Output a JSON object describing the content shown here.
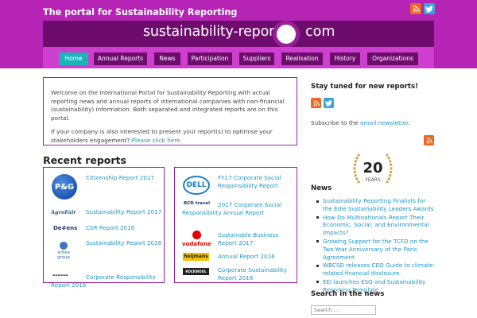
{
  "header": {
    "tagline": "The portal for Sustainability Reporting",
    "brand_left": "sustainability-reports",
    "brand_right": "com"
  },
  "nav": {
    "items": [
      {
        "label": "Home",
        "active": true
      },
      {
        "label": "Annual Reports",
        "active": false
      },
      {
        "label": "News",
        "active": false
      },
      {
        "label": "Participation",
        "active": false
      },
      {
        "label": "Suppliers",
        "active": false
      },
      {
        "label": "Realisation",
        "active": false
      },
      {
        "label": "History",
        "active": false
      },
      {
        "label": "Organizations",
        "active": false
      }
    ]
  },
  "welcome": {
    "para1": "Welcome on the International Portal for Sustainability Reporting with actual reporting news and annual reports of international companies with non-financial (sustainability) information. Both separated and integrated reports are on this portal.",
    "para2_prefix": "If your company is also interested to present your report(s) to optimise your stakeholders engagement?",
    "para2_link": "Please click here."
  },
  "recent": {
    "title": "Recent reports",
    "left": [
      {
        "logo": "P&G",
        "report": "Citizenship Report 2017"
      },
      {
        "logo": "AgroFair",
        "report": "Sustainability Report 2017"
      },
      {
        "logo": "De#ens",
        "report": "CSR Report 2016"
      },
      {
        "logo": "antea group",
        "report": "Sustainability Report 2016"
      },
      {
        "logo": "",
        "report": "Corporate Responsibility Report 2016"
      }
    ],
    "right": [
      {
        "logo": "DELL",
        "report": "FY17 Corporate Social Responsibility Report"
      },
      {
        "logo": "BCD travel",
        "report": "2017 Corporate Social Responsibility Annual Report"
      },
      {
        "logo": "vodafone",
        "report": "Sustainable Business Report 2017"
      },
      {
        "logo": "heijmans",
        "report": "Annual Report 2016"
      },
      {
        "logo": "ROCKWOOL",
        "report": "Corporate Sustainability Report 2016"
      }
    ]
  },
  "sidebar": {
    "stay_tuned": "Stay tuned for new reports!",
    "subscribe_prefix": "Subscribe to the",
    "subscribe_link": "email newsletter",
    "subscribe_suffix": ".",
    "years_number": "20",
    "years_label": "YEARS",
    "news_title": "News",
    "news": [
      "Sustainability Reporting Finalists for the Edie Sustainability Leaders Awards",
      "How Do Multinationals Report Their Economic, Social, and Environmental Impacts?",
      "Growing Support for the TCFD on the Two-Year Anniversary of the Paris Agreement",
      "WBCSD releases CEO Guide to climate-related financial disclosure",
      "EEI launches ESG and Sustainability Reporting Template"
    ],
    "search_title": "Search in the news",
    "search_placeholder": "Search ..."
  },
  "colors": {
    "header_purple": "#b624b6",
    "brand_dark": "#6e0c6e",
    "nav_active": "#1ab3b8",
    "link": "#1d97c4",
    "rss": "#f26522",
    "twitter": "#3da3e0"
  }
}
